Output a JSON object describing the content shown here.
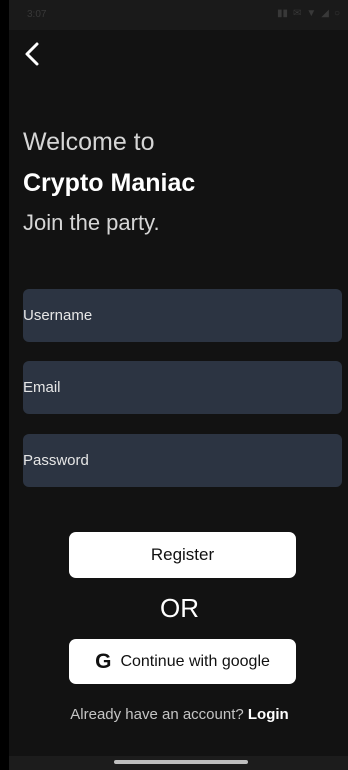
{
  "status_bar": {
    "time": "3:07",
    "icons": [
      "signal-icon",
      "message-icon",
      "wifi-icon",
      "cell-icon",
      "battery-icon"
    ]
  },
  "header": {
    "back_icon": "chevron-left-icon"
  },
  "welcome": {
    "line1": "Welcome to",
    "app_name": "Crypto Maniac",
    "tagline": "Join the party."
  },
  "form": {
    "username_placeholder": "Username",
    "email_placeholder": "Email",
    "password_placeholder": "Password"
  },
  "actions": {
    "register_label": "Register",
    "or_label": "OR",
    "google_icon": "G",
    "google_label": "Continue with google",
    "login_prompt": "Already have an account?",
    "login_link": "Login"
  },
  "colors": {
    "background": "#121212",
    "field": "#2c3442",
    "button": "#ffffff",
    "text": "#ffffff"
  }
}
